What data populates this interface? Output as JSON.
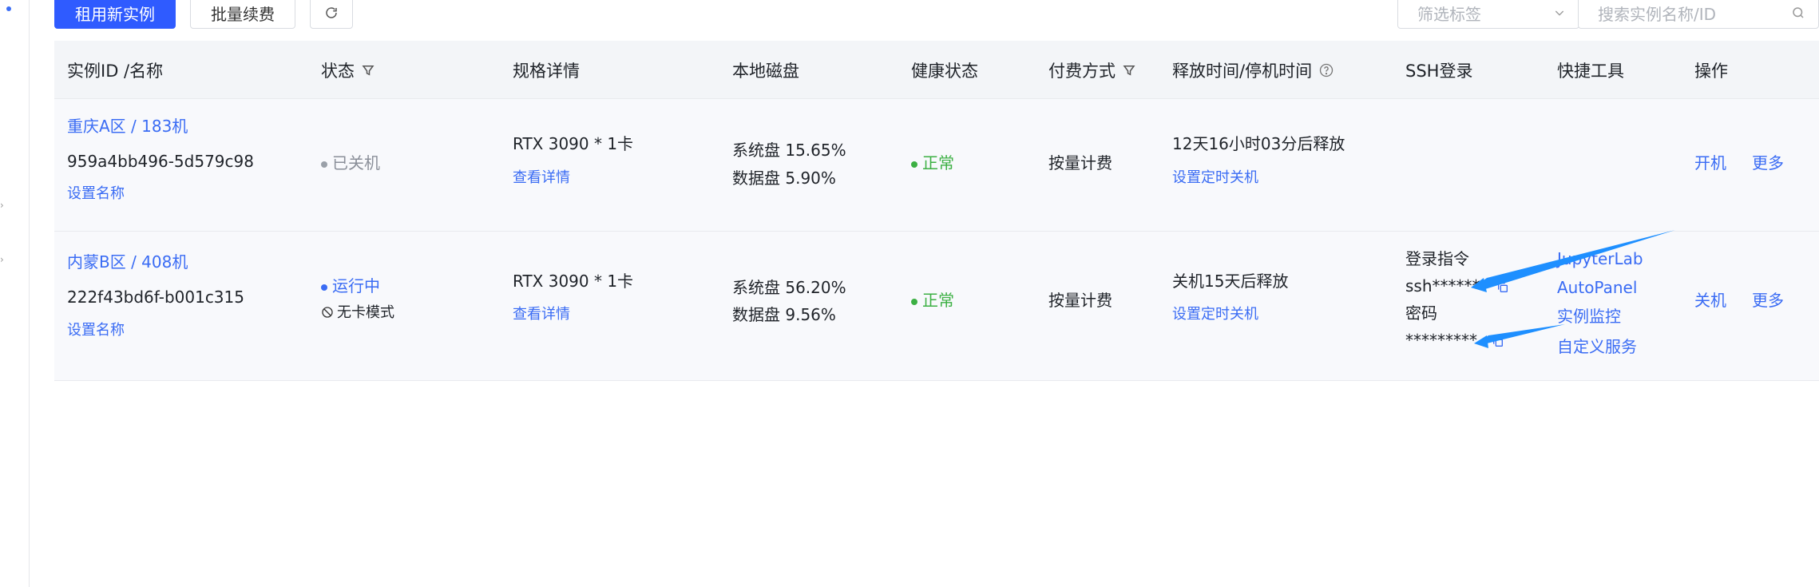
{
  "toolbar": {
    "new_instance": "租用新实例",
    "batch_renew": "批量续费",
    "filter_tags_placeholder": "筛选标签",
    "search_placeholder": "搜索实例名称/ID"
  },
  "table": {
    "headers": {
      "id_name": "实例ID /名称",
      "status": "状态",
      "spec": "规格详情",
      "disk": "本地磁盘",
      "health": "健康状态",
      "billing": "付费方式",
      "release": "释放时间/停机时间",
      "ssh": "SSH登录",
      "tools": "快捷工具",
      "actions": "操作"
    },
    "rows": [
      {
        "region": "重庆A区 / 183机",
        "id": "959a4bb496-5d579c98",
        "set_name": "设置名称",
        "status": "已关机",
        "spec": "RTX 3090 * 1卡",
        "spec_detail": "查看详情",
        "disk_sys": "系统盘 15.65%",
        "disk_data": "数据盘 5.90%",
        "health": "正常",
        "billing": "按量计费",
        "release": "12天16小时03分后释放",
        "timer": "设置定时关机",
        "action_power": "开机",
        "action_more": "更多"
      },
      {
        "region": "内蒙B区 / 408机",
        "id": "222f43bd6f-b001c315",
        "set_name": "设置名称",
        "status": "运行中",
        "mode": "无卡模式",
        "spec": "RTX 3090 * 1卡",
        "spec_detail": "查看详情",
        "disk_sys": "系统盘 56.20%",
        "disk_data": "数据盘 9.56%",
        "health": "正常",
        "billing": "按量计费",
        "release": "关机15天后释放",
        "timer": "设置定时关机",
        "ssh_cmd_label": "登录指令",
        "ssh_cmd": "ssh******",
        "ssh_pwd_label": "密码",
        "ssh_pwd": "*********",
        "tools": [
          "JupyterLab",
          "AutoPanel",
          "实例监控",
          "自定义服务"
        ],
        "action_power": "关机",
        "action_more": "更多"
      }
    ]
  },
  "colors": {
    "primary": "#2f5bff",
    "link": "#3a6cf4",
    "healthy": "#3cb043",
    "annotation_arrow": "#1e8fff"
  }
}
